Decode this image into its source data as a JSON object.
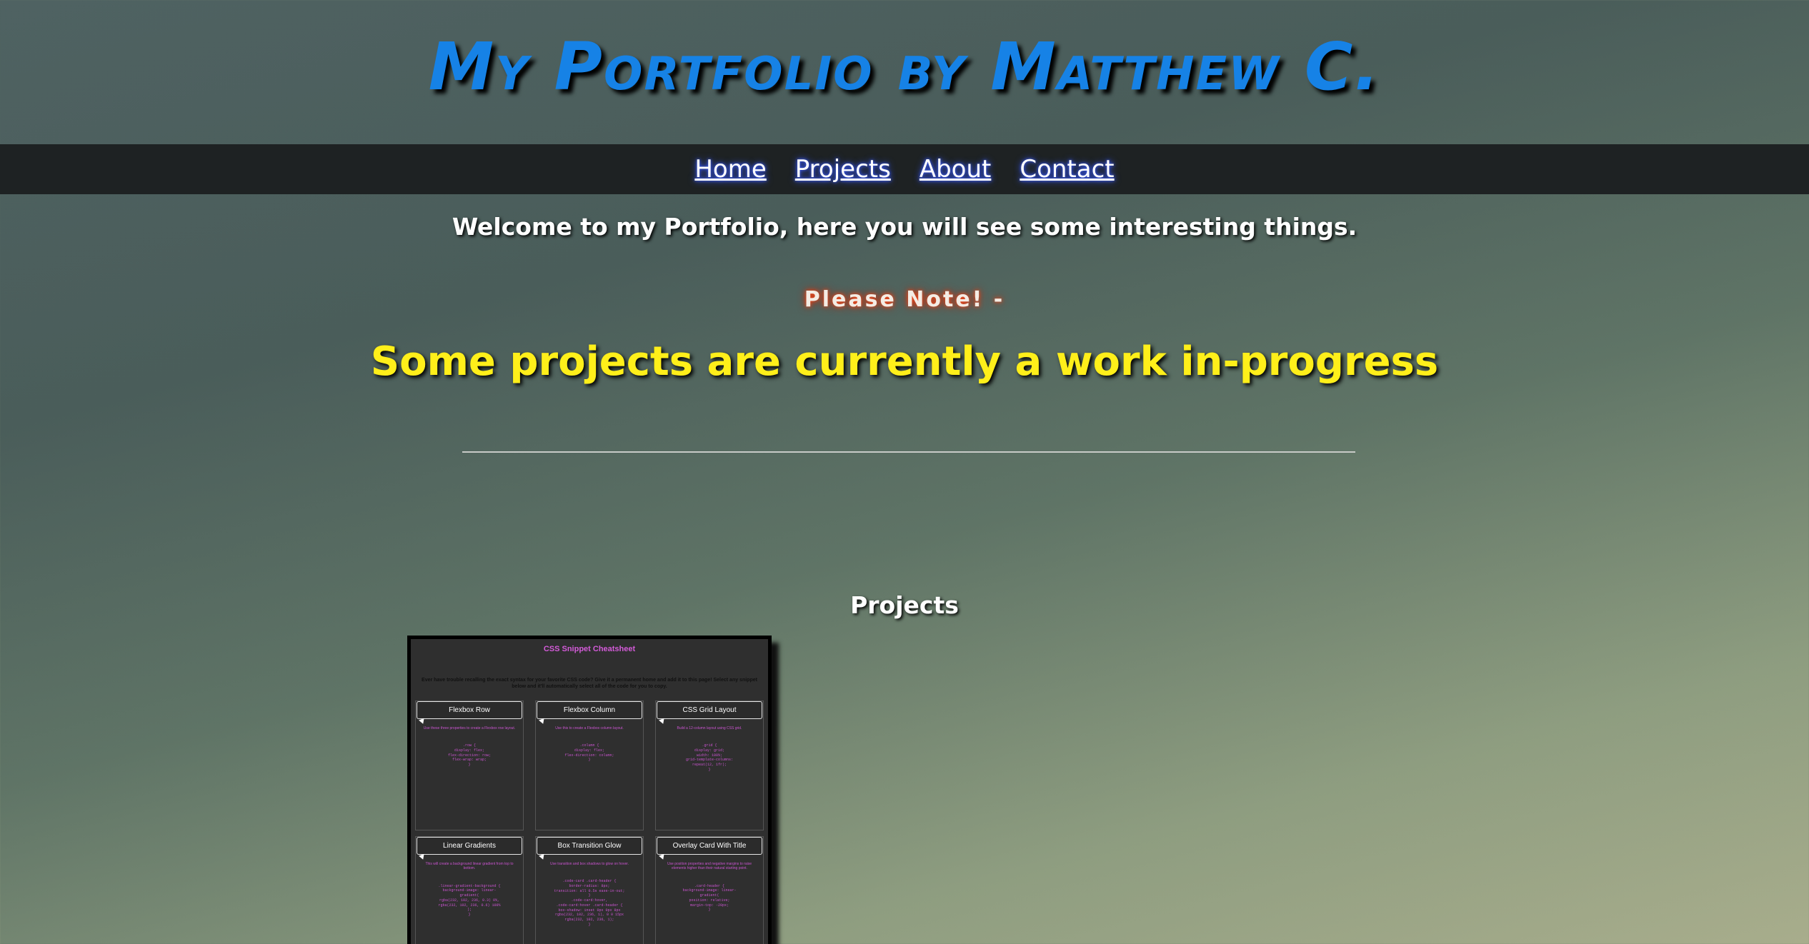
{
  "header": {
    "title": "My Portfolio by Matthew C."
  },
  "nav": {
    "items": [
      "Home",
      "Projects",
      "About",
      "Contact"
    ]
  },
  "main": {
    "welcome": "Welcome to my Portfolio, here you will see some interesting things.",
    "note": "Please Note! -",
    "wip": "Some projects are currently a work in-progress",
    "projects_heading": "Projects"
  },
  "project_preview": {
    "title": "CSS Snippet Cheatsheet",
    "intro": "Ever have trouble recalling the exact syntax for your favorite CSS code? Give it a permanent home and add it to this page! Select any snippet below and it'll automatically select all of the code for you to copy.",
    "cards": [
      {
        "label": "Flexbox Row",
        "desc": "Use these three properties to create a Flexbox row layout.",
        "code": ".row {\ndisplay: flex;\nflex-direction: row;\nflex-wrap: wrap;\n}"
      },
      {
        "label": "Flexbox Column",
        "desc": "Use this to create a Flexbox column layout.",
        "code": ".column {\ndisplay: flex;\nflex-direction: column;\n}"
      },
      {
        "label": "CSS Grid Layout",
        "desc": "Build a 12-column layout using CSS grid.",
        "code": ".grid {\ndisplay: grid;\nwidth: 100%;\ngrid-template-columns:\nrepeat(12, 1fr);\n}"
      },
      {
        "label": "Linear Gradients",
        "desc": "This will create a background linear gradient from top to bottom.",
        "code": ".linear-gradient-background {\nbackground-image: linear-\ngradient(\nrgba(232, 102, 236, 0.3) 0%,\nrgba(232, 102, 236, 0.6) 100%\n);\n}"
      },
      {
        "label": "Box Transition Glow",
        "desc": "Use transition and box shadows to glow on hover.",
        "code": ".code-card .card-header {\nborder-radius: 8px;\ntransition: all 0.5s ease-in-out;\n}\n.code-card:hover,\n.code-card:hover .card-header {\nbox-shadow: inset 0px 0px 8px\nrgba(232, 102, 236, 1), 0 0 15px\nrgba(232, 102, 236, 1);\n}"
      },
      {
        "label": "Overlay Card With Title",
        "desc": "Use position properties and negative margins to raise elements higher than their natural starting point.",
        "code": ".card-header {\nbackground-image: linear-\ngradient(\nposition: relative;\nmargin-top: -20px;\n}"
      }
    ]
  },
  "colors": {
    "title": "#1682e6",
    "nav_bg": "#1e2223",
    "wip": "#ffef1a",
    "note_glow": "#ff4a1a",
    "preview_accent": "#d35bd8"
  }
}
